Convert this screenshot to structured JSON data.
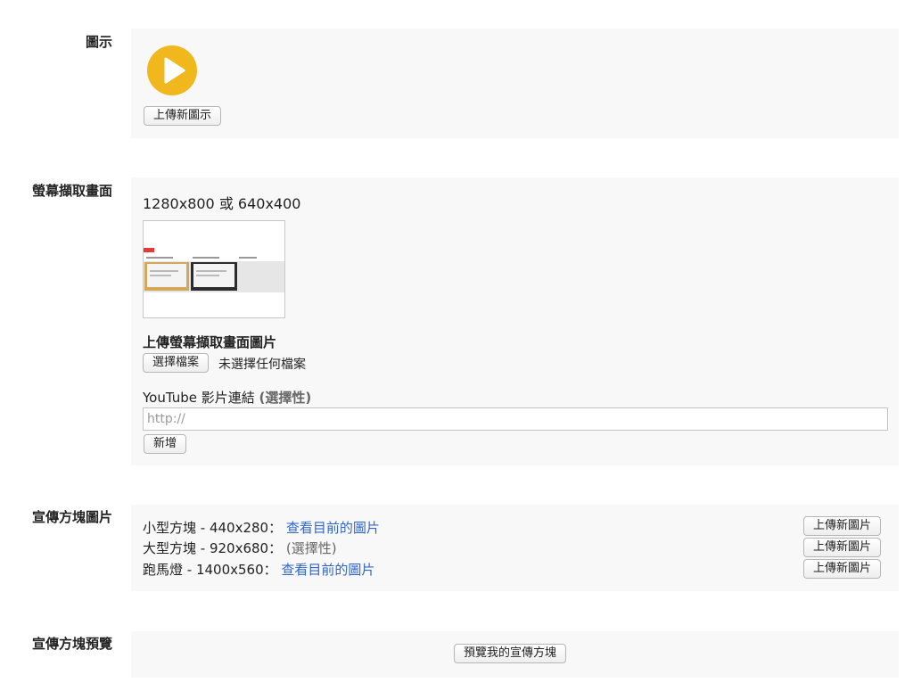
{
  "icon_section": {
    "label": "圖示",
    "upload_button": "上傳新圖示",
    "icon": "play-icon",
    "icon_color": "#f0b81c"
  },
  "screenshot_section": {
    "label": "螢幕擷取畫面",
    "sizes": "1280x800 或 640x400",
    "upload_title": "上傳螢幕擷取畫面圖片",
    "choose_file_button": "選擇檔案",
    "no_file_text": "未選擇任何檔案",
    "youtube_label": "YouTube 影片連結",
    "youtube_optional": "(選擇性)",
    "youtube_placeholder": "http://",
    "youtube_value": "",
    "add_button": "新增"
  },
  "promo_section": {
    "label": "宣傳方塊圖片",
    "rows": [
      {
        "name": "小型方塊 - 440x280：",
        "action": "查看目前的圖片",
        "action_is_link": true,
        "upload_button": "上傳新圖片"
      },
      {
        "name": "大型方塊 - 920x680：",
        "action": "(選擇性)",
        "action_is_link": false,
        "upload_button": "上傳新圖片"
      },
      {
        "name": "跑馬燈 - 1400x560：",
        "action": "查看目前的圖片",
        "action_is_link": true,
        "upload_button": "上傳新圖片"
      }
    ]
  },
  "preview_section": {
    "label": "宣傳方塊預覽",
    "preview_button": "預覽我的宣傳方塊"
  },
  "colors": {
    "link": "#3366cc",
    "panel_bg": "#f8f8f8",
    "accent_red": "#e53935"
  }
}
